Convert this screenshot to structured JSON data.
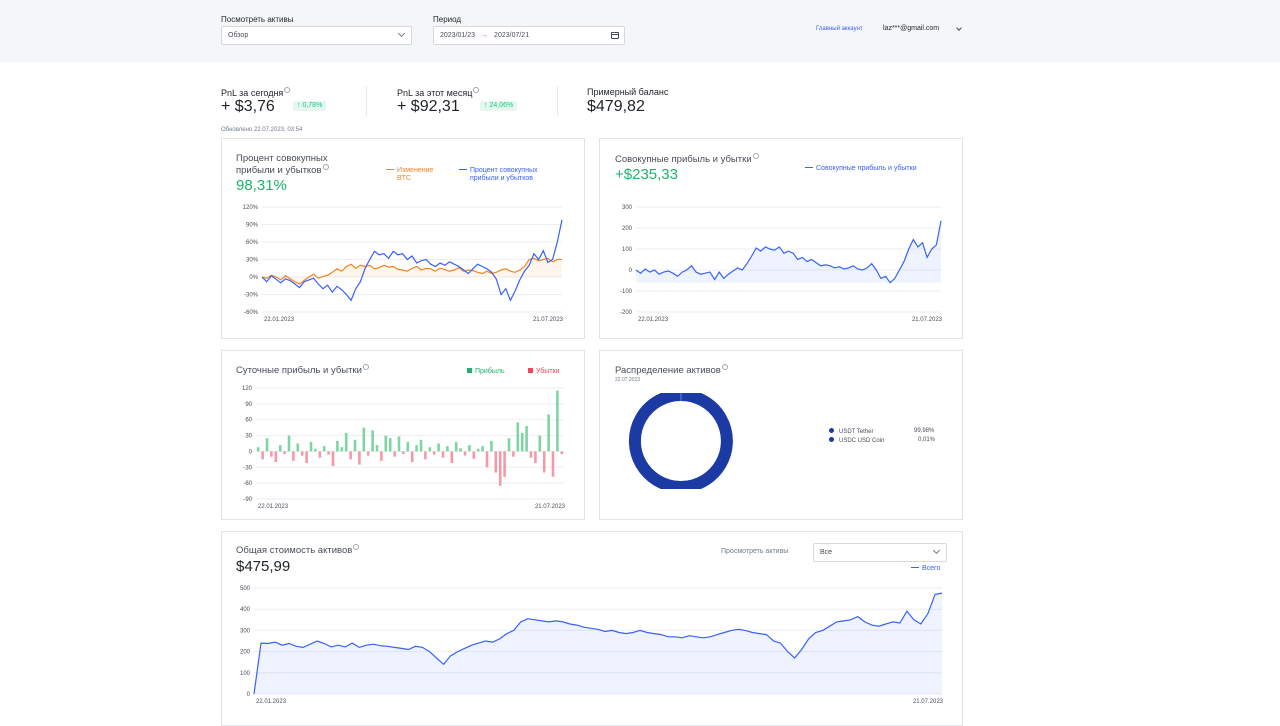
{
  "header": {
    "view_assets_label": "Посмотреть активы",
    "view_assets_value": "Обзор",
    "period_label": "Период",
    "date_from": "2023/01/23",
    "date_to": "2023/07/21",
    "main_account": "Главный аккаунт",
    "email": "laz***@gmail.com"
  },
  "stats": {
    "pnl_today_label": "PnL за сегодня",
    "pnl_today_value": "+ $3,76",
    "pnl_today_pct": "0,78%",
    "pnl_month_label": "PnL за этот месяц",
    "pnl_month_value": "+ $92,31",
    "pnl_month_pct": "24,06%",
    "balance_label": "Примерный баланс",
    "balance_value": "$479,82",
    "updated": "Обновлено 22.07.2023, 03:54"
  },
  "colors": {
    "blue": "#3861fb",
    "orange": "#f0841f",
    "green": "#20b26c",
    "red": "#f6465d",
    "navy": "#1c3aa3"
  },
  "cards": {
    "cumulative_pct": {
      "title_line1": "Процент совокупных",
      "title_line2": "прибыли и убытков",
      "value": "98,31%",
      "legend_btc_line1": "Изменение",
      "legend_btc_line2": "BTC",
      "legend_pct_line1": "Процент совокупных",
      "legend_pct_line2": "прибыли и убытков"
    },
    "cumulative_pnl": {
      "title": "Совокупные прибыль и убытки",
      "value": "+$235,33",
      "legend": "Совокупные прибыль и убытки"
    },
    "daily_pnl": {
      "title": "Суточные прибыль и убытки",
      "legend_profit": "Прибыль",
      "legend_loss": "Убытки"
    },
    "allocation": {
      "title": "Распределение активов",
      "date": "22.07.2023",
      "assets": [
        {
          "name": "USDT Tether",
          "pct": "99,98%"
        },
        {
          "name": "USDC USD Coin",
          "pct": "0,01%"
        }
      ]
    },
    "total_value": {
      "title": "Общая стоимость активов",
      "value": "$475,99",
      "view_label": "Просмотреть активы",
      "select_value": "Все",
      "legend": "Всего"
    }
  },
  "chart_data": [
    {
      "type": "line",
      "title": "Процент совокупных прибыли и убытков",
      "x_labels": [
        "22.01.2023",
        "21.07.2023"
      ],
      "y_ticks": [
        "120%",
        "90%",
        "60%",
        "30%",
        "0%",
        "-30%",
        "-60%"
      ],
      "ylim": [
        -60,
        120
      ],
      "series": [
        {
          "name": "Изменение BTC",
          "color": "#f0841f",
          "values": [
            0,
            -2,
            3,
            0,
            -5,
            2,
            -3,
            -8,
            -12,
            -6,
            0,
            5,
            -2,
            1,
            3,
            8,
            14,
            10,
            18,
            22,
            15,
            20,
            18,
            20,
            14,
            16,
            20,
            17,
            18,
            13,
            12,
            10,
            15,
            18,
            12,
            15,
            14,
            10,
            15,
            13,
            10,
            12,
            16,
            10,
            12,
            11,
            8,
            6,
            10,
            6,
            8,
            12,
            14,
            10,
            8,
            12,
            18,
            30,
            32,
            28,
            30,
            32,
            26,
            30,
            30
          ]
        },
        {
          "name": "Процент совокупных прибыли и убытков",
          "color": "#3861fb",
          "values": [
            0,
            -8,
            2,
            -4,
            -10,
            -3,
            -6,
            -12,
            -18,
            -8,
            -5,
            -2,
            -12,
            -20,
            -14,
            -26,
            -16,
            -22,
            -30,
            -40,
            -20,
            -8,
            15,
            30,
            44,
            38,
            40,
            32,
            44,
            38,
            40,
            30,
            36,
            24,
            28,
            30,
            22,
            18,
            24,
            20,
            26,
            22,
            18,
            12,
            6,
            14,
            22,
            18,
            14,
            8,
            -4,
            -30,
            -20,
            -40,
            -24,
            -5,
            10,
            20,
            40,
            30,
            45,
            25,
            30,
            60,
            98
          ]
        }
      ]
    },
    {
      "type": "area",
      "title": "Совокупные прибыль и убытки",
      "x_labels": [
        "22.01.2023",
        "21.07.2023"
      ],
      "y_ticks": [
        "300",
        "200",
        "100",
        "0",
        "-100",
        "-200"
      ],
      "ylim": [
        -200,
        300
      ],
      "series": [
        {
          "name": "Совокупные прибыль и убытки",
          "color": "#3861fb",
          "values": [
            0,
            -15,
            5,
            -10,
            0,
            -20,
            -10,
            -5,
            -15,
            -30,
            -10,
            0,
            20,
            -10,
            -20,
            -15,
            -10,
            -45,
            -10,
            -40,
            -20,
            -5,
            10,
            0,
            30,
            65,
            105,
            90,
            110,
            100,
            95,
            110,
            80,
            90,
            80,
            50,
            60,
            40,
            50,
            35,
            20,
            25,
            20,
            10,
            15,
            5,
            10,
            20,
            5,
            0,
            10,
            30,
            0,
            -40,
            -30,
            -60,
            -40,
            0,
            40,
            100,
            145,
            110,
            130,
            60,
            100,
            120,
            235
          ]
        }
      ]
    },
    {
      "type": "bar",
      "title": "Суточные прибыль и убытки",
      "x_labels": [
        "22.01.2023",
        "21.07.2023"
      ],
      "y_ticks": [
        "120",
        "90",
        "60",
        "30",
        "0",
        "-30",
        "-60",
        "-90"
      ],
      "ylim": [
        -90,
        120
      ],
      "values": [
        8,
        -15,
        25,
        -10,
        -20,
        12,
        -5,
        30,
        -18,
        15,
        -8,
        -22,
        18,
        5,
        -12,
        10,
        -6,
        -28,
        20,
        8,
        35,
        -15,
        22,
        -25,
        45,
        -8,
        40,
        12,
        -18,
        30,
        25,
        -10,
        28,
        -5,
        18,
        -20,
        12,
        22,
        -15,
        8,
        -6,
        15,
        -12,
        10,
        -22,
        18,
        6,
        -8,
        12,
        -14,
        5,
        10,
        -30,
        20,
        -40,
        -65,
        -48,
        25,
        -10,
        55,
        35,
        48,
        -12,
        -22,
        30,
        -40,
        70,
        -48,
        115,
        -5
      ]
    },
    {
      "type": "pie",
      "title": "Распределение активов",
      "categories": [
        "USDT Tether",
        "USDC USD Coin"
      ],
      "values": [
        99.98,
        0.01
      ]
    },
    {
      "type": "area",
      "title": "Общая стоимость активов",
      "x_labels": [
        "22.01.2023",
        "21.07.2023"
      ],
      "y_ticks": [
        "500",
        "400",
        "300",
        "200",
        "100",
        "0"
      ],
      "ylim": [
        0,
        500
      ],
      "series": [
        {
          "name": "Всего",
          "color": "#3861fb",
          "values": [
            0,
            240,
            238,
            245,
            230,
            238,
            225,
            220,
            235,
            250,
            238,
            222,
            230,
            222,
            240,
            220,
            230,
            235,
            228,
            225,
            220,
            215,
            210,
            225,
            220,
            200,
            170,
            140,
            180,
            200,
            215,
            230,
            240,
            250,
            245,
            260,
            285,
            300,
            340,
            355,
            350,
            345,
            340,
            345,
            340,
            330,
            325,
            315,
            310,
            305,
            295,
            300,
            290,
            285,
            290,
            300,
            290,
            285,
            280,
            270,
            270,
            265,
            275,
            270,
            265,
            270,
            280,
            290,
            300,
            305,
            300,
            290,
            285,
            280,
            250,
            240,
            200,
            170,
            210,
            260,
            290,
            300,
            320,
            340,
            345,
            350,
            365,
            340,
            325,
            320,
            330,
            340,
            335,
            390,
            350,
            330,
            380,
            470,
            476
          ]
        }
      ]
    }
  ]
}
